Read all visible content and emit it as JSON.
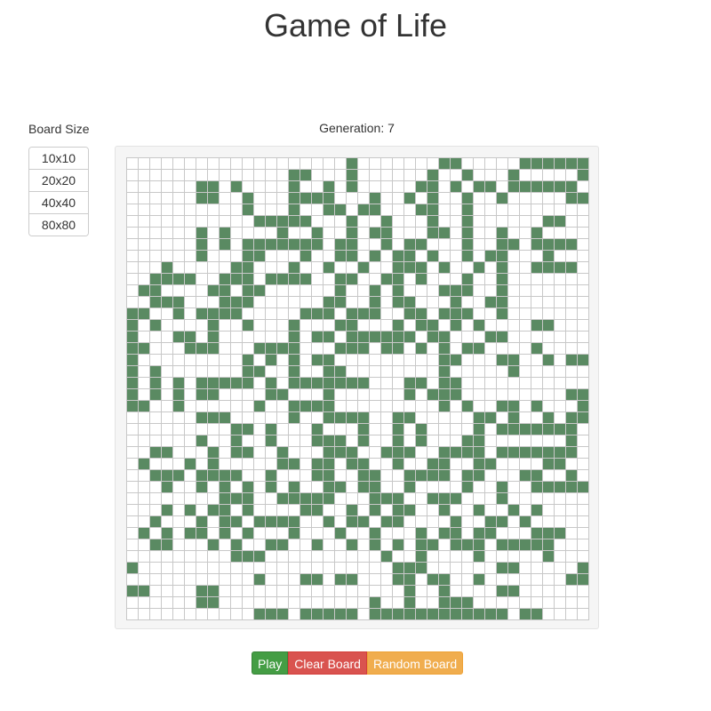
{
  "title": "Game of Life",
  "board_size": {
    "label": "Board Size",
    "options": [
      "10x10",
      "20x20",
      "40x40",
      "80x80"
    ]
  },
  "generation": {
    "label": "Generation:",
    "value": 7,
    "text": "Generation: 7"
  },
  "controls": {
    "play": "Play",
    "clear": "Clear Board",
    "random": "Random Board"
  },
  "colors": {
    "alive": "#5a8a62",
    "dead": "#ffffff",
    "grid": "#c8c8c8",
    "play": "#449d44",
    "clear": "#d9534f",
    "random": "#f0ad4e"
  },
  "board": {
    "rows": 40,
    "cols": 40,
    "cells": [
      "...................#.......##.....######",
      "..............##...#......#..#...#.....#",
      "......##.#....#..#.#.....##.#.##.######.",
      "......##..#...####...#..#.#..#..#.....##",
      "..........#...#..##.##...##..#..........",
      "...........#####...#..#...#..#......##..",
      "......#.#....#..#..#.##...##.#..#..#....",
      "......#.#.#######.##..#.##...#..##.####.",
      "......#...##...#..##.#.##.#..#.##...#...",
      "...#.....##...#..#..#..###.#..#.#..####.",
      "..####..###.####..##..##.#...#..#.......",
      ".##....##.##......#..#.#...###..#.......",
      "..###...###......##..#.##...#..##.......",
      "##..#.####.....###.###..##.###..#.......",
      "#.#....#..#...#...##...#.##.#.#....##...",
      "#...##.#......#.##.######.##...##.......",
      "##...###...####...###.##.#.#.##....#....",
      "#.........#.#.#.##.........##...##..#.##",
      "#.#.......##..#..##........#.....#......",
      "#.#.#.#####.#.#######...##.##...........",
      "#.#.#.##....##...#......#.###.........##",
      "##..#......#..####.........#.#..##.#...#",
      "......###.....#..####..##.....##.#..#.##",
      ".........##.#...#...#..#.#....#.#######",
      "......#..#..#...###.#..#.#...##.......#",
      "..##...#.##..#...###..###..####.#######",
      ".#...#.#.....##.##.##..#..##..##....##..",
      "..###.####..#...##..##..####.##...##..#.",
      "...#..#.#.#.#.#..##.##..#....#..#..#####",
      "........###..#####...###..###...#.......",
      "...#.#.##.#....##..#.#.##..#..#..#.#....",
      "..#...#.##.####..#.##.##....#..##.#.....",
      ".#.#.##.#.#...#...#..#...#.##.##...###..",
      "..##...#.#..##..#..#.#.#.##.###.#####...",
      ".........###..........#..#....#.....#...",
      "#......................###......##.....##",
      "...........#...##.##...##.##..#.......##",
      "##....##................#..#....##......",
      "......##.............#..#..###..........",
      "...........###.#####.############.##...."
    ]
  }
}
